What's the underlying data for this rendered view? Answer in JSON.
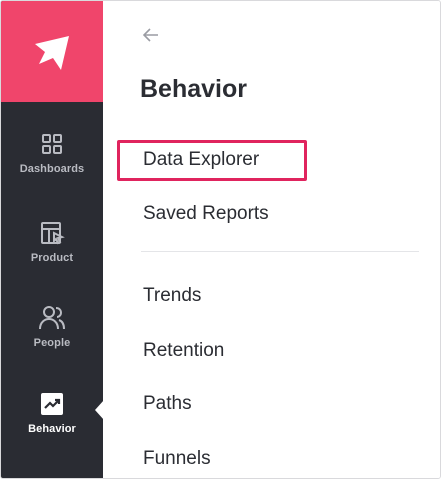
{
  "brand": {
    "logo_icon": "arrow-logo-icon",
    "color": "#f0456b"
  },
  "rail": {
    "items": [
      {
        "label": "Dashboards",
        "icon": "grid-icon"
      },
      {
        "label": "Product",
        "icon": "product-icon"
      },
      {
        "label": "People",
        "icon": "people-icon"
      },
      {
        "label": "Behavior",
        "icon": "trend-chart-icon",
        "active": true
      }
    ]
  },
  "panel": {
    "back_icon": "back-arrow-icon",
    "title": "Behavior",
    "section_primary": [
      "Data Explorer",
      "Saved Reports"
    ],
    "section_secondary": [
      "Trends",
      "Retention",
      "Paths",
      "Funnels"
    ],
    "highlighted": "Data Explorer",
    "highlight_color": "#e0245e"
  }
}
